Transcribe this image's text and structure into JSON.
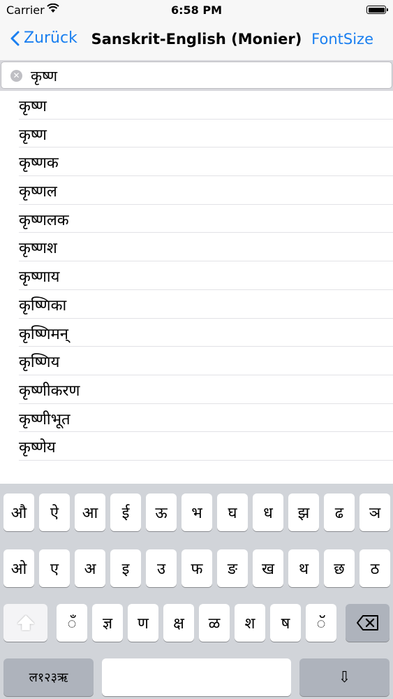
{
  "status": {
    "carrier": "Carrier",
    "time": "6:58 PM"
  },
  "nav": {
    "back_label": "Zurück",
    "title": "Sanskrit-English (Monier)",
    "right_label": "FontSize"
  },
  "search": {
    "value": "कृष्ण"
  },
  "results": [
    "कृष्ण",
    "कृष्ण",
    "कृष्णक",
    "कृष्णल",
    "कृष्णलक",
    "कृष्णश",
    "कृष्णाय",
    "कृष्णिका",
    "कृष्णिमन्",
    "कृष्णिय",
    "कृष्णीकरण",
    "कृष्णीभूत",
    "कृष्णेय"
  ],
  "keyboard": {
    "row1": [
      "औ",
      "ऐ",
      "आ",
      "ई",
      "ऊ",
      "भ",
      "घ",
      "ध",
      "झ",
      "ढ",
      "ञ"
    ],
    "row2": [
      "ओ",
      "ए",
      "अ",
      "इ",
      "उ",
      "फ",
      "ङ",
      "ख",
      "थ",
      "छ",
      "ठ"
    ],
    "row3": [
      "ँ",
      "ज्ञ",
      "ण",
      "क्ष",
      "ळ",
      "श",
      "ष",
      "ॅ"
    ],
    "mode_key": "ल१२३ऋ",
    "space_label": "",
    "return_symbol": "⇩"
  },
  "colors": {
    "accent": "#1a7ff0",
    "keyboard_bg": "#d1d4d9"
  }
}
